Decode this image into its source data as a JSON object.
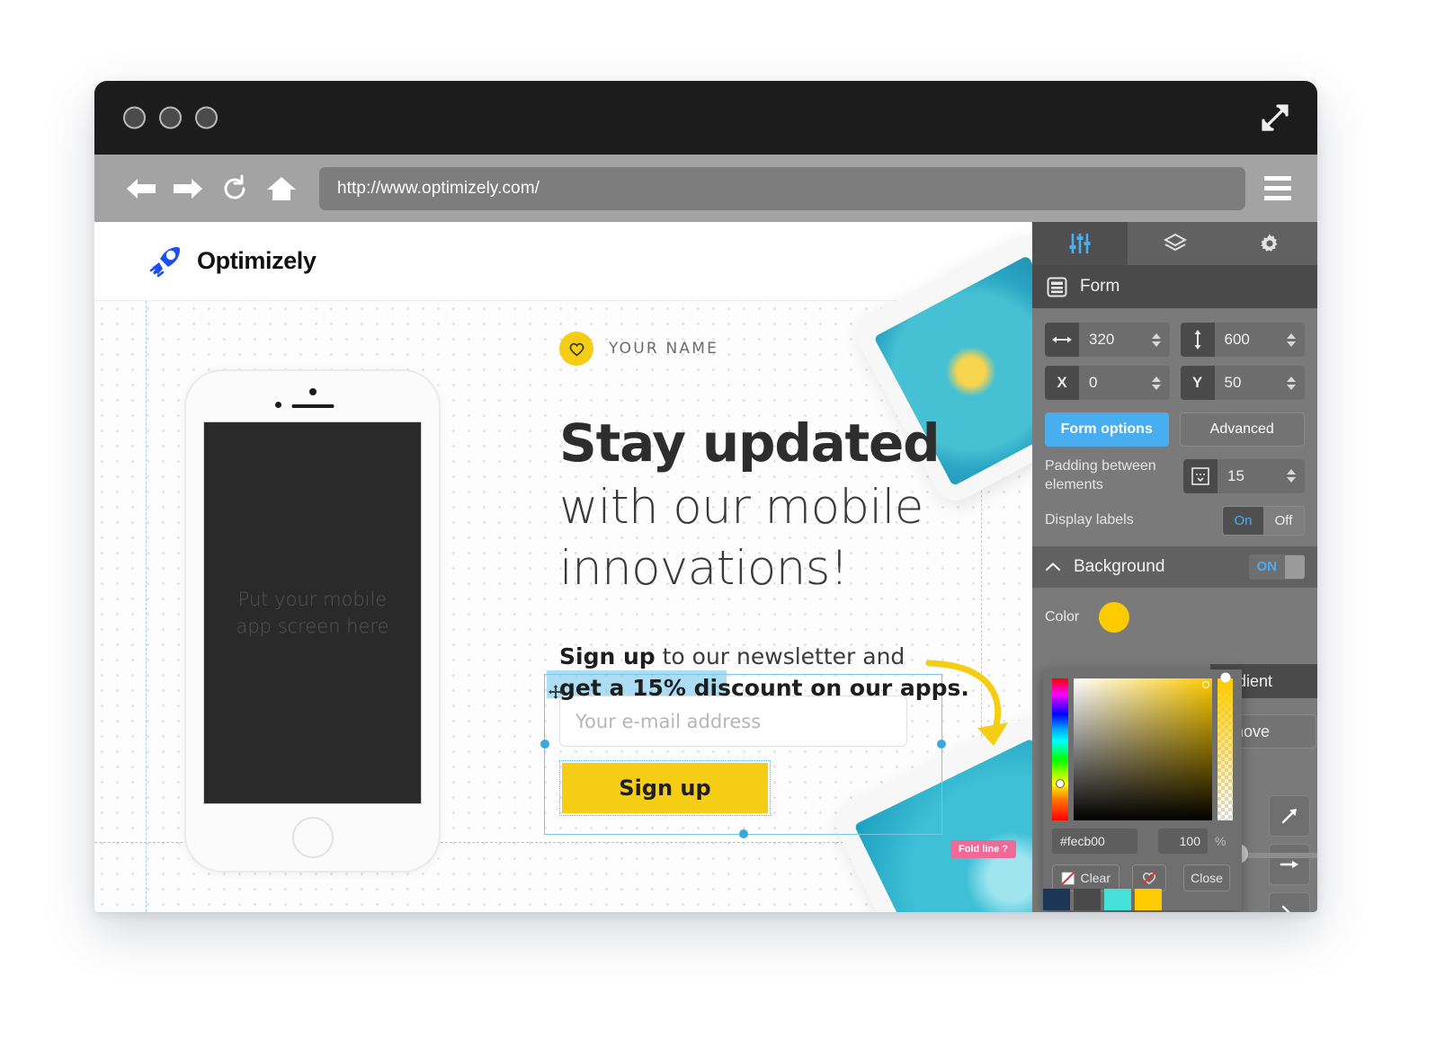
{
  "browser": {
    "url": "http://www.optimizely.com/",
    "nav": {
      "back": "back-arrow",
      "forward": "forward-arrow",
      "reload": "reload",
      "home": "home"
    },
    "menu_label": "menu",
    "expand_label": "expand"
  },
  "site": {
    "logo_text": "Optimizely",
    "brand_name": "YOUR NAME",
    "headline_bold": "Stay updated",
    "headline_line2": "with our mobile",
    "headline_line3": "innovations!",
    "sub_bold": "Sign up",
    "sub_rest": " to our newsletter and",
    "sub_line2": "get a 15% discount on our apps.",
    "email_placeholder": "Your e-mail address",
    "signup_button": "Sign up",
    "phone_placeholder": "Put your mobile\napp screen here",
    "fold_line_badge": "Fold line ?"
  },
  "editor": {
    "tabs": [
      {
        "name": "properties",
        "icon": "sliders-icon",
        "active": true
      },
      {
        "name": "layers",
        "icon": "layers-icon",
        "active": false
      },
      {
        "name": "settings",
        "icon": "gear-icon",
        "active": false
      }
    ],
    "title": "Form",
    "title_icon": "form-icon",
    "fields": {
      "width_label": "width",
      "width_value": "320",
      "height_label": "height",
      "height_value": "600",
      "x_label": "X",
      "x_value": "0",
      "y_label": "Y",
      "y_value": "50"
    },
    "buttons": {
      "form_options": "Form options",
      "advanced": "Advanced"
    },
    "padding": {
      "label": "Padding between elements",
      "value": "15"
    },
    "display_labels": {
      "label": "Display labels",
      "on": "On",
      "off": "Off",
      "selected": "On"
    },
    "background": {
      "section_title": "Background",
      "toggle_state": "ON",
      "color_label": "Color",
      "color_value": "#fecb00",
      "gradient_label": "Gradient",
      "remove_label": "Remove",
      "directions": [
        "arrow-up-right-icon",
        "arrow-right-icon",
        "arrow-down-right-icon"
      ]
    },
    "color_picker": {
      "hex": "#fecb00",
      "alpha": "100",
      "alpha_unit": "%",
      "clear_label": "Clear",
      "close_label": "Close",
      "no_color_icon": "no-heart-icon",
      "swatches": [
        "#1d3557",
        "#4a4a4a",
        "#45e0d8",
        "#fecb00"
      ]
    }
  },
  "colors": {
    "accent_blue": "#49aef0",
    "brand_yellow": "#f5cd14",
    "picker_yellow": "#fecb00",
    "panel_bg": "#7a7a7a",
    "titlebar": "#1c1c1c",
    "toolbar": "#a3a3a3",
    "fold_pink": "#ef6a96"
  }
}
